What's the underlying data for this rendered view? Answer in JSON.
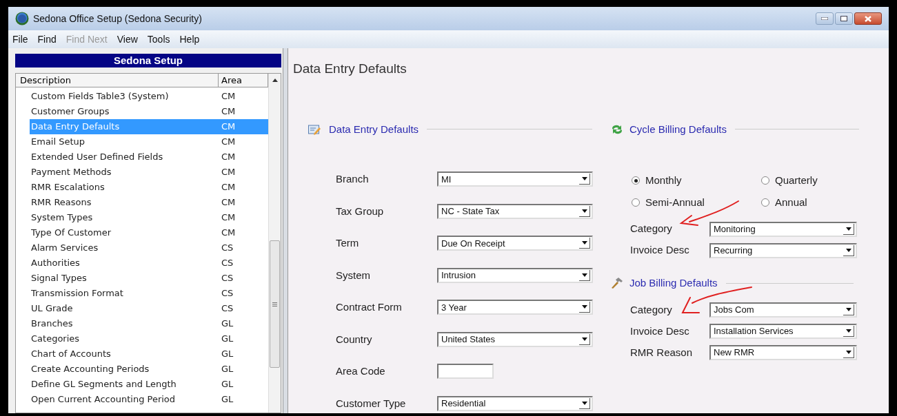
{
  "window": {
    "title": "Sedona Office Setup (Sedona Security)"
  },
  "menu": [
    {
      "label": "File",
      "disabled": false
    },
    {
      "label": "Find",
      "disabled": false
    },
    {
      "label": "Find Next",
      "disabled": true
    },
    {
      "label": "View",
      "disabled": false
    },
    {
      "label": "Tools",
      "disabled": false
    },
    {
      "label": "Help",
      "disabled": false
    }
  ],
  "sidebar": {
    "title": "Sedona Setup",
    "columns": [
      "Description",
      "Area"
    ],
    "rows": [
      {
        "description": "Custom Fields Table3 (System)",
        "area": "CM",
        "selected": false
      },
      {
        "description": "Customer Groups",
        "area": "CM",
        "selected": false
      },
      {
        "description": "Data Entry Defaults",
        "area": "CM",
        "selected": true
      },
      {
        "description": "Email Setup",
        "area": "CM",
        "selected": false
      },
      {
        "description": "Extended User Defined Fields",
        "area": "CM",
        "selected": false
      },
      {
        "description": "Payment Methods",
        "area": "CM",
        "selected": false
      },
      {
        "description": "RMR Escalations",
        "area": "CM",
        "selected": false
      },
      {
        "description": "RMR Reasons",
        "area": "CM",
        "selected": false
      },
      {
        "description": "System Types",
        "area": "CM",
        "selected": false
      },
      {
        "description": "Type Of Customer",
        "area": "CM",
        "selected": false
      },
      {
        "description": "Alarm Services",
        "area": "CS",
        "selected": false
      },
      {
        "description": "Authorities",
        "area": "CS",
        "selected": false
      },
      {
        "description": "Signal Types",
        "area": "CS",
        "selected": false
      },
      {
        "description": "Transmission Format",
        "area": "CS",
        "selected": false
      },
      {
        "description": "UL Grade",
        "area": "CS",
        "selected": false
      },
      {
        "description": "Branches",
        "area": "GL",
        "selected": false
      },
      {
        "description": "Categories",
        "area": "GL",
        "selected": false
      },
      {
        "description": "Chart of Accounts",
        "area": "GL",
        "selected": false
      },
      {
        "description": "Create Accounting Periods",
        "area": "GL",
        "selected": false
      },
      {
        "description": "Define GL Segments and Length",
        "area": "GL",
        "selected": false
      },
      {
        "description": "Open Current Accounting Period",
        "area": "GL",
        "selected": false
      }
    ]
  },
  "content": {
    "title": "Data Entry Defaults",
    "data_entry": {
      "heading": "Data Entry Defaults",
      "fields": [
        {
          "label": "Branch",
          "kind": "dropdown",
          "value": "MI"
        },
        {
          "label": "Tax Group",
          "kind": "dropdown",
          "value": "NC - State Tax"
        },
        {
          "label": "Term",
          "kind": "dropdown",
          "value": "Due On Receipt"
        },
        {
          "label": "System",
          "kind": "dropdown",
          "value": "Intrusion"
        },
        {
          "label": "Contract Form",
          "kind": "dropdown",
          "value": "3 Year"
        },
        {
          "label": "Country",
          "kind": "dropdown",
          "value": "United States"
        },
        {
          "label": "Area Code",
          "kind": "text"
        },
        {
          "label": "Customer Type",
          "kind": "dropdown",
          "value": "Residential"
        }
      ]
    },
    "cycle_billing": {
      "heading": "Cycle Billing Defaults",
      "options": [
        {
          "label": "Monthly",
          "selected": true
        },
        {
          "label": "Quarterly",
          "selected": false
        },
        {
          "label": "Semi-Annual",
          "selected": false
        },
        {
          "label": "Annual",
          "selected": false
        }
      ],
      "fields": [
        {
          "label": "Category",
          "kind": "dropdown",
          "value": "Monitoring"
        },
        {
          "label": "Invoice Desc",
          "kind": "dropdown",
          "value": "Recurring"
        }
      ]
    },
    "job_billing": {
      "heading": "Job Billing Defaults",
      "fields": [
        {
          "label": "Category",
          "kind": "dropdown",
          "value": "Jobs Com"
        },
        {
          "label": "Invoice Desc",
          "kind": "dropdown",
          "value": "Installation Services"
        },
        {
          "label": "RMR Reason",
          "kind": "dropdown",
          "value": "New RMR"
        }
      ]
    }
  }
}
